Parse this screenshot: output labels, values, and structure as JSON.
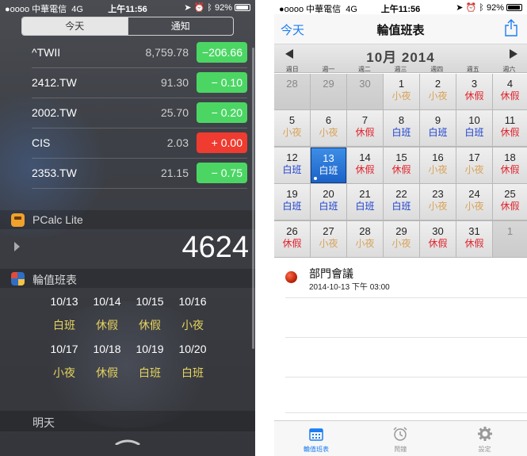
{
  "left": {
    "status": {
      "carrier": "●oooo 中華電信",
      "network": "4G",
      "time": "上午11:56",
      "battery": "92%"
    },
    "segments": {
      "today": "今天",
      "notifications": "通知"
    },
    "stocks": [
      {
        "symbol": "^TWII",
        "price": "8,759.78",
        "change": "−206.66",
        "direction": "up"
      },
      {
        "symbol": "2412.TW",
        "price": "91.30",
        "change": "−  0.10",
        "direction": "up"
      },
      {
        "symbol": "2002.TW",
        "price": "25.70",
        "change": "−  0.20",
        "direction": "up"
      },
      {
        "symbol": "CIS",
        "price": "2.03",
        "change": "+  0.00",
        "direction": "down"
      },
      {
        "symbol": "2353.TW",
        "price": "21.15",
        "change": "−  0.75",
        "direction": "up"
      }
    ],
    "pcalc": {
      "title": "PCalc Lite",
      "value": "4624"
    },
    "shift_widget": {
      "title": "輪值班表",
      "days": [
        {
          "date": "10/13",
          "shift": "白班"
        },
        {
          "date": "10/14",
          "shift": "休假"
        },
        {
          "date": "10/15",
          "shift": "休假"
        },
        {
          "date": "10/16",
          "shift": "小夜"
        },
        {
          "date": "10/17",
          "shift": "小夜"
        },
        {
          "date": "10/18",
          "shift": "休假"
        },
        {
          "date": "10/19",
          "shift": "白班"
        },
        {
          "date": "10/20",
          "shift": "白班"
        }
      ]
    },
    "tomorrow": "明天"
  },
  "right": {
    "status": {
      "carrier": "●oooo 中華電信",
      "network": "4G",
      "time": "上午11:56",
      "battery": "92%"
    },
    "nav": {
      "today_button": "今天",
      "title": "輪值班表"
    },
    "calendar": {
      "month_label": "10月 2014",
      "weekdays": [
        "週日",
        "週一",
        "週二",
        "週三",
        "週四",
        "週五",
        "週六"
      ],
      "cells": [
        {
          "day": "28",
          "shift": "",
          "other": true
        },
        {
          "day": "29",
          "shift": "",
          "other": true
        },
        {
          "day": "30",
          "shift": "",
          "other": true
        },
        {
          "day": "1",
          "shift": "小夜"
        },
        {
          "day": "2",
          "shift": "小夜"
        },
        {
          "day": "3",
          "shift": "休假"
        },
        {
          "day": "4",
          "shift": "休假"
        },
        {
          "day": "5",
          "shift": "小夜"
        },
        {
          "day": "6",
          "shift": "小夜"
        },
        {
          "day": "7",
          "shift": "休假"
        },
        {
          "day": "8",
          "shift": "白班"
        },
        {
          "day": "9",
          "shift": "白班"
        },
        {
          "day": "10",
          "shift": "白班"
        },
        {
          "day": "11",
          "shift": "休假"
        },
        {
          "day": "12",
          "shift": "白班"
        },
        {
          "day": "13",
          "shift": "白班",
          "selected": true
        },
        {
          "day": "14",
          "shift": "休假"
        },
        {
          "day": "15",
          "shift": "休假"
        },
        {
          "day": "16",
          "shift": "小夜"
        },
        {
          "day": "17",
          "shift": "小夜"
        },
        {
          "day": "18",
          "shift": "休假"
        },
        {
          "day": "19",
          "shift": "白班"
        },
        {
          "day": "20",
          "shift": "白班"
        },
        {
          "day": "21",
          "shift": "白班"
        },
        {
          "day": "22",
          "shift": "白班"
        },
        {
          "day": "23",
          "shift": "小夜"
        },
        {
          "day": "24",
          "shift": "小夜"
        },
        {
          "day": "25",
          "shift": "休假"
        },
        {
          "day": "26",
          "shift": "休假"
        },
        {
          "day": "27",
          "shift": "小夜"
        },
        {
          "day": "28",
          "shift": "小夜"
        },
        {
          "day": "29",
          "shift": "小夜"
        },
        {
          "day": "30",
          "shift": "休假"
        },
        {
          "day": "31",
          "shift": "休假"
        },
        {
          "day": "1",
          "shift": "",
          "other": true
        }
      ]
    },
    "event": {
      "title": "部門會議",
      "time": "2014-10-13 下午 03:00"
    },
    "tabs": [
      {
        "label": "輪值班表",
        "icon": "calendar-icon",
        "active": true
      },
      {
        "label": "鬧鐘",
        "icon": "alarm-clock-icon",
        "active": false
      },
      {
        "label": "設定",
        "icon": "gear-icon",
        "active": false
      }
    ]
  },
  "colors": {
    "accent_blue": "#1a7df2",
    "stock_up": "#4bd664",
    "stock_down": "#f03b30",
    "shift_day": "#1b3fcf",
    "shift_off": "#e2202a",
    "shift_night": "#d8a35a",
    "widget_shift_text": "#e6d35d"
  }
}
